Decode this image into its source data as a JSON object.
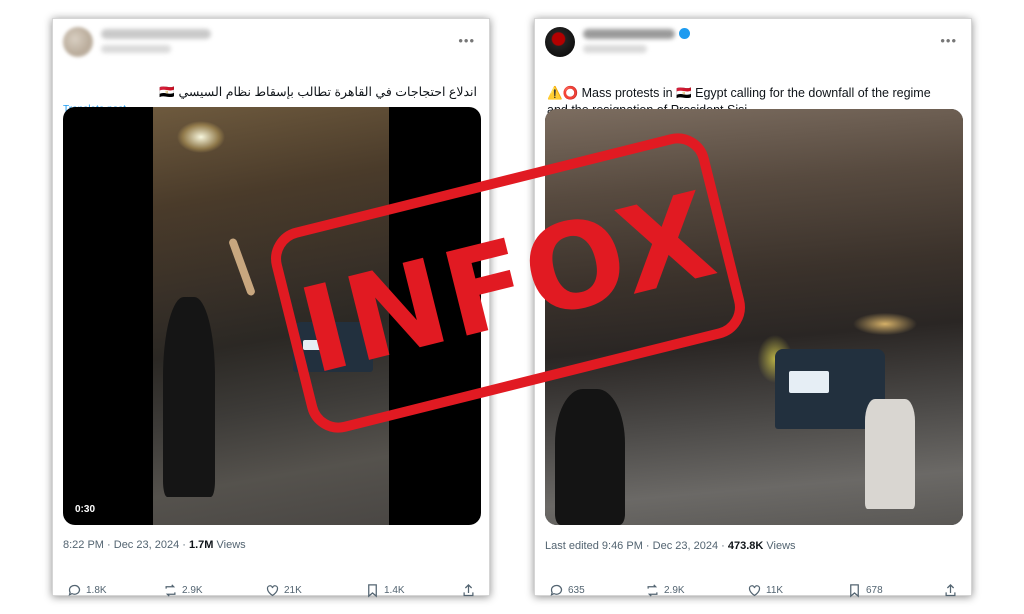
{
  "left_post": {
    "text": "اندلاع احتجاجات في القاهرة تطالب بإسقاط نظام السيسي 🇪🇬",
    "translate_link": "Translate post",
    "video_duration": "0:30",
    "time": "8:22 PM",
    "date": "Dec 23, 2024",
    "views_count": "1.7M",
    "views_label": "Views",
    "stats": {
      "replies": "1.8K",
      "reposts": "2.9K",
      "likes": "21K",
      "bookmarks": "1.4K"
    }
  },
  "right_post": {
    "text_line1": "⚠️⭕ Mass protests in 🇪🇬 Egypt calling for the downfall of the regime",
    "text_line2": "and the resignation of President Sisi.",
    "edited_prefix": "Last edited",
    "time": "9:46 PM",
    "date": "Dec 23, 2024",
    "views_count": "473.8K",
    "views_label": "Views",
    "stats": {
      "replies": "635",
      "reposts": "2.9K",
      "likes": "11K",
      "bookmarks": "678"
    }
  },
  "stamp": {
    "text": "INFOX",
    "color": "#e11a22"
  },
  "colors": {
    "link": "#1d9bf0",
    "muted": "#536471",
    "text": "#0f1419"
  }
}
